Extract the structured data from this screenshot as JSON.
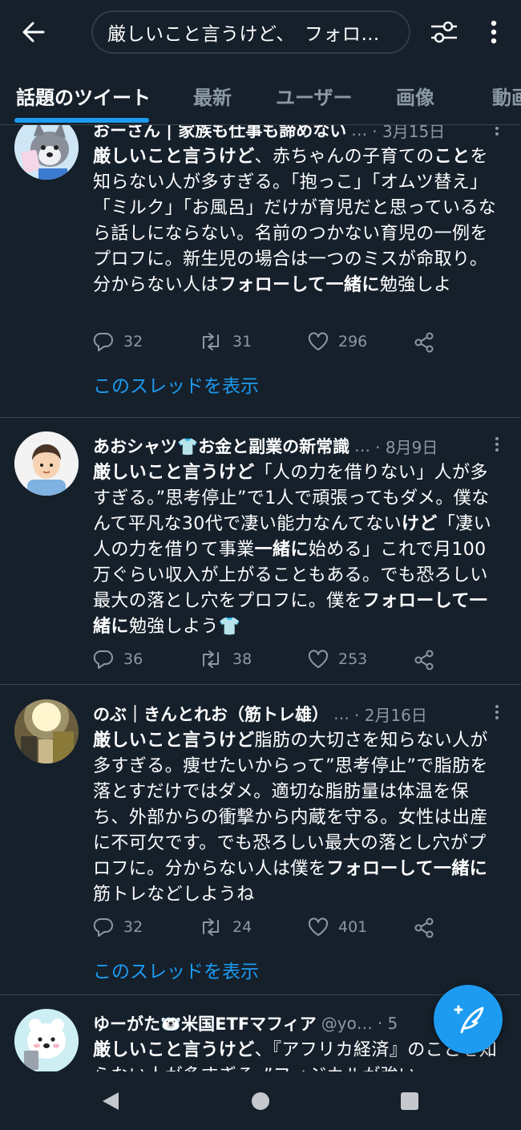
{
  "search": {
    "query": "厳しいこと言うけど、　フォロ…"
  },
  "tabs": [
    {
      "label": "話題のツイート",
      "active": true
    },
    {
      "label": "最新"
    },
    {
      "label": "ユーザー"
    },
    {
      "label": "画像"
    },
    {
      "label": "動画"
    }
  ],
  "tweets": [
    {
      "name": "おーさん | 家族も仕事も諦めない",
      "handle_ellipsis": "…",
      "date": "· 3月15日",
      "body_html": "<b>厳しいこと言うけど</b>、赤ちゃんの子育ての<b>こと</b>を知らない人が多すぎる。「抱っこ」「オムツ替え」「ミルク」「お風呂」だけが育児だと思っているなら話しにならない。名前のつかない育児の一例をプロフに。新生児の場合は一つのミスが命取り。分からない人は<b>フォローして一緒に</b>勉強しよ",
      "replies": "32",
      "retweets": "31",
      "likes": "296",
      "thread": "このスレッドを表示"
    },
    {
      "name": "あおシャツ👕お金と副業の新常識",
      "handle_ellipsis": "…",
      "date": "· 8月9日",
      "body_html": "<b>厳しいこと言うけど</b>「人の力を借りない」人が多すぎる。”思考停止”で1人で頑張ってもダメ。僕なんて平凡な30代で凄い能力なんてない<b>けど</b>「凄い人の力を借りて事業<b>一緒に</b>始める」これで月100万ぐらい収入が上がることもある。でも恐ろしい最大の落とし穴をプロフに。僕を<b>フォローして一緒に</b>勉強しよう👕",
      "replies": "36",
      "retweets": "38",
      "likes": "253"
    },
    {
      "name": "のぶ｜きんとれお（筋トレ雄）",
      "handle_ellipsis": "…",
      "date": "· 2月16日",
      "body_html": "<b>厳しいこと言うけど</b>脂肪の大切さを知らない人が多すぎる。痩せたいからって”思考停止”で脂肪を落とすだけではダメ。適切な脂肪量は体温を保ち、外部からの衝撃から内蔵を守る。女性は出産に不可欠です。でも恐ろしい最大の落とし穴がプロフに。分からない人は僕を<b>フォローして一緒に</b>筋トレなどしようね",
      "replies": "32",
      "retweets": "24",
      "likes": "401",
      "thread": "このスレッドを表示"
    },
    {
      "name": "ゆーがた🐻‍❄️米国ETFマフィア",
      "handle": "@yo…",
      "date": "· 5",
      "body_html": "<b>厳しいこと言うけど</b>、『アフリカ経済』のことを知らない人が多すぎる。”フィジカルが強い"
    }
  ],
  "colors": {
    "background": "#15202b",
    "accent": "#1d9bf0",
    "muted": "#8b98a5",
    "divider": "#38444d"
  },
  "icons": [
    "back-arrow-icon",
    "filter-sliders-icon",
    "more-vertical-icon",
    "reply-icon",
    "retweet-icon",
    "like-heart-icon",
    "share-icon",
    "compose-feather-icon",
    "nav-back-icon",
    "nav-home-icon",
    "nav-recents-icon"
  ]
}
